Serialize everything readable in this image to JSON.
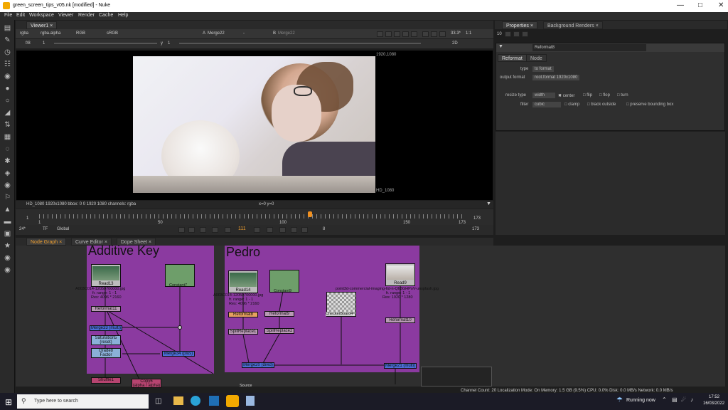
{
  "window": {
    "title": "green_screen_tips_v05.nk [modified] - Nuke"
  },
  "menu": [
    "File",
    "Edit",
    "Workspace",
    "Viewer",
    "Render",
    "Cache",
    "Help"
  ],
  "viewer": {
    "tab": "Viewer1",
    "channels": "rgba",
    "alpha": "rgba.alpha",
    "color": "RGB",
    "lut": "sRGB",
    "a_input": "Merge22",
    "a_op": "-",
    "b_input": "Merge22",
    "zoom": "33.3*",
    "ratio": "1:1",
    "mode": "2D",
    "fstop": "f/8",
    "frame_step": "1",
    "y_label": "y",
    "y_val": "1",
    "format_tr": "1920,1080",
    "format_br": "HD_1080",
    "status": "HD_1080 1920x1080  bbox: 0 0 1920 1080 channels: rgba",
    "coords": "x=0 y=0"
  },
  "timeline": {
    "start": "1",
    "ticks": [
      "1",
      "50",
      "100",
      "150",
      "173"
    ],
    "end": "173",
    "fps": "24*",
    "tf": "TF",
    "global": "Global",
    "current": "111",
    "step": "8",
    "end2": "173"
  },
  "properties": {
    "tabs": [
      "Properties",
      "Background Renders"
    ],
    "count": "10",
    "node_name": "Reformat8",
    "subtabs": [
      "Reformat",
      "Node"
    ],
    "type_label": "type",
    "type_val": "to format",
    "outfmt_label": "output format",
    "outfmt_val": "root.format 1920x1080",
    "resize_label": "resize type",
    "resize_val": "width",
    "center": "center",
    "flip": "flip",
    "flop": "flop",
    "turn": "turn",
    "filter_label": "filter",
    "filter_val": "cubic",
    "clamp": "clamp",
    "black_outside": "black outside",
    "preserve": "preserve bounding box"
  },
  "nodegraph": {
    "tabs": [
      "Node Graph",
      "Curve Editor",
      "Dope Sheet"
    ],
    "groups": [
      "Additive Key",
      "Pedro"
    ],
    "nodes": {
      "read13": "Read13",
      "read13_file": "A003C014-12050700000.jpg",
      "read13_range": "fr. range: 1 - 1",
      "read13_res": "Res: 4096 * 2160",
      "const7": "Constant7",
      "reformat11": "Reformat11",
      "merge_left": "Merge33 (multi)",
      "sat": "Saturation5",
      "sat2": "(reset)",
      "grade": "Grade8",
      "grade2": "Factor",
      "merge34": "Merge34 (plus)",
      "shuffle": "Shuffle1",
      "copy": "Copy6",
      "copy2": "(alpha / alpha)",
      "read14": "Read14",
      "read14_file": "A003C014-12050700000.jpg",
      "read14_range": "fr. range: 1 - 1",
      "read14_res": "Res: 4096 * 2160",
      "const9": "Constant9",
      "reformat8": "Reformat8",
      "reformat9": "Reformat9",
      "spill1": "SpillReplace1",
      "spill2": "SpillReplace2",
      "checker": "CheckerBoard4",
      "merge_p": "Merge20 (divid)",
      "read9": "Read9",
      "read9_file": "point3d-commercial-imaging-ltd-n-Qh8GHPoV-unsplash.jpg",
      "read9_range": "fr. range: 1 - 1",
      "read9_res": "Res: 1920 * 1280",
      "reformat10": "Reformat10",
      "merge_r": "Merge21 (multi)",
      "source": "Source"
    }
  },
  "statusbar": "Channel Count: 20  Localization Mode: On  Memory: 1.5 GB (9.5%)  CPU: 0.0%  Disk: 0.0 MB/s  Network: 0.0 MB/s",
  "taskbar": {
    "search": "Type here to search",
    "weather": "Running now",
    "time": "17:52",
    "date": "16/03/2022"
  }
}
